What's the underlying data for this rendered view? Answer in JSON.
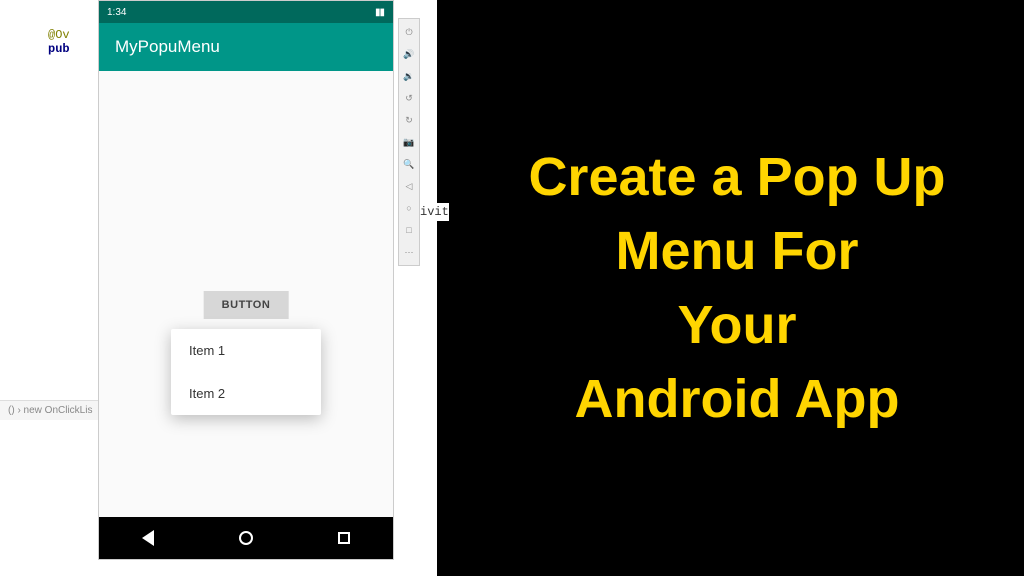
{
  "ide": {
    "code_line1": "@Ov",
    "code_line2_keyword": "pub",
    "breadcrumb": "() › new OnClickLis",
    "text_frag": "ivit"
  },
  "emulator": {
    "status_time": "1:34",
    "app_title": "MyPopuMenu",
    "button_label": "BUTTON",
    "popup_items": [
      "Item 1",
      "Item 2"
    ]
  },
  "title": {
    "line1": "Create a Pop Up",
    "line2": "Menu For",
    "line3": "Your",
    "line4": "Android App"
  }
}
